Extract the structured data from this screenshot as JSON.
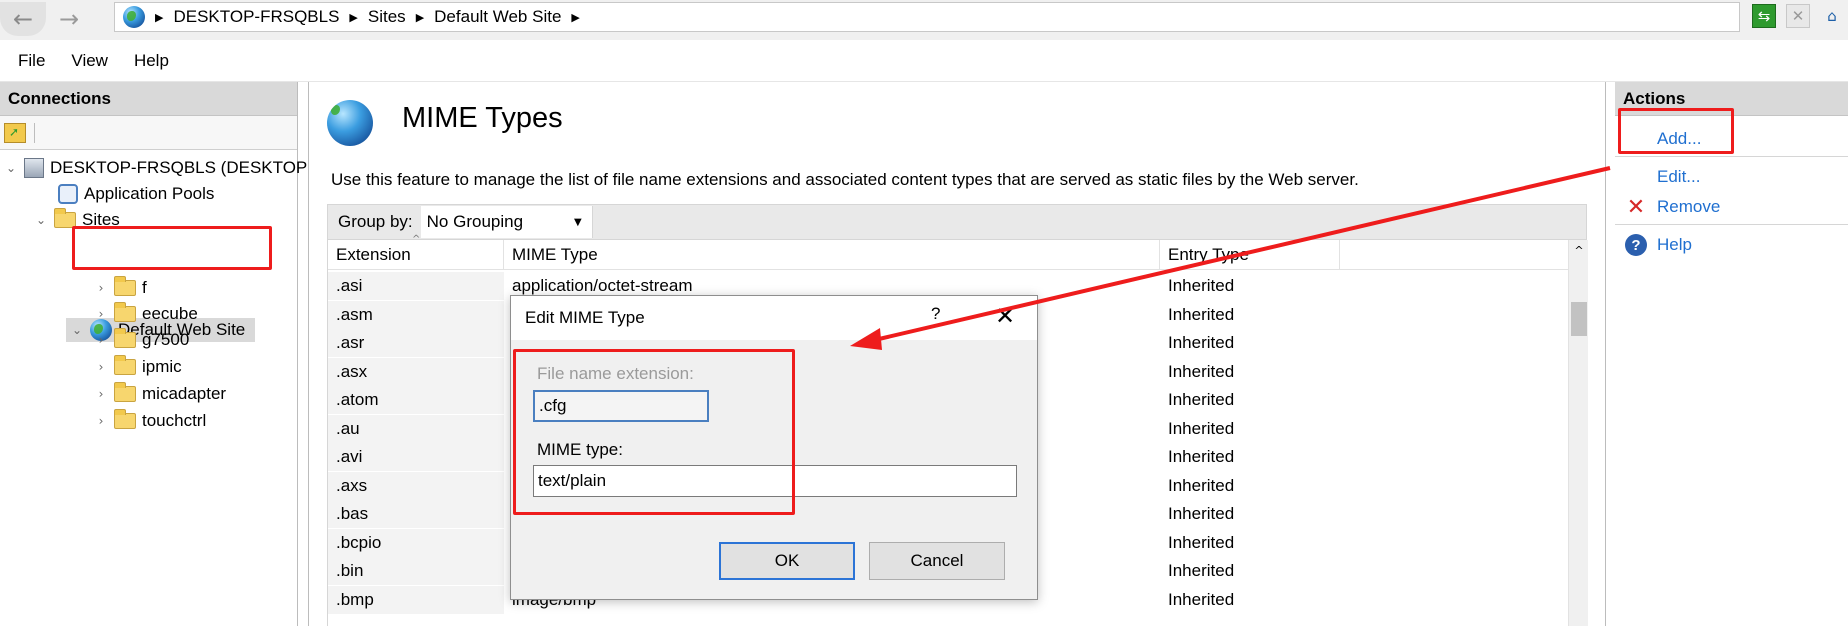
{
  "address_bar": {
    "back_icon": "back-arrow-icon",
    "forward_icon": "forward-arrow-icon",
    "breadcrumb": [
      "DESKTOP-FRSQBLS",
      "Sites",
      "Default Web Site"
    ]
  },
  "menu": [
    "File",
    "View",
    "Help"
  ],
  "connections": {
    "title": "Connections",
    "tree": {
      "server": "DESKTOP-FRSQBLS (DESKTOP",
      "app_pools": "Application Pools",
      "sites": "Sites",
      "default_site": "Default Web Site",
      "children": [
        "f",
        "eecube",
        "g7500",
        "ipmic",
        "micadapter",
        "touchctrl"
      ]
    }
  },
  "main": {
    "title": "MIME Types",
    "description": "Use this feature to manage the list of file name extensions and associated content types that are served as static files by the Web server.",
    "group_by_label": "Group by:",
    "group_by_value": "No Grouping",
    "columns": [
      "Extension",
      "MIME Type",
      "Entry Type"
    ],
    "rows": [
      {
        "ext": ".asi",
        "mime": "application/octet-stream",
        "entry": "Inherited"
      },
      {
        "ext": ".asm",
        "mime": "",
        "entry": "Inherited"
      },
      {
        "ext": ".asr",
        "mime": "",
        "entry": "Inherited"
      },
      {
        "ext": ".asx",
        "mime": "",
        "entry": "Inherited"
      },
      {
        "ext": ".atom",
        "mime": "",
        "entry": "Inherited"
      },
      {
        "ext": ".au",
        "mime": "",
        "entry": "Inherited"
      },
      {
        "ext": ".avi",
        "mime": "",
        "entry": "Inherited"
      },
      {
        "ext": ".axs",
        "mime": "",
        "entry": "Inherited"
      },
      {
        "ext": ".bas",
        "mime": "",
        "entry": "Inherited"
      },
      {
        "ext": ".bcpio",
        "mime": "",
        "entry": "Inherited"
      },
      {
        "ext": ".bin",
        "mime": "",
        "entry": "Inherited"
      },
      {
        "ext": ".bmp",
        "mime": "image/bmp",
        "entry": "Inherited"
      }
    ]
  },
  "actions": {
    "title": "Actions",
    "add": "Add...",
    "edit": "Edit...",
    "remove": "Remove",
    "help": "Help"
  },
  "dialog": {
    "title": "Edit MIME Type",
    "help_glyph": "?",
    "ext_label": "File name extension:",
    "ext_value": ".cfg",
    "mime_label": "MIME type:",
    "mime_value": "text/plain",
    "ok": "OK",
    "cancel": "Cancel"
  },
  "colors": {
    "annotation_red": "#ee1c1c",
    "link_blue": "#1f6fd0",
    "panel_header": "#d9d9d9"
  }
}
